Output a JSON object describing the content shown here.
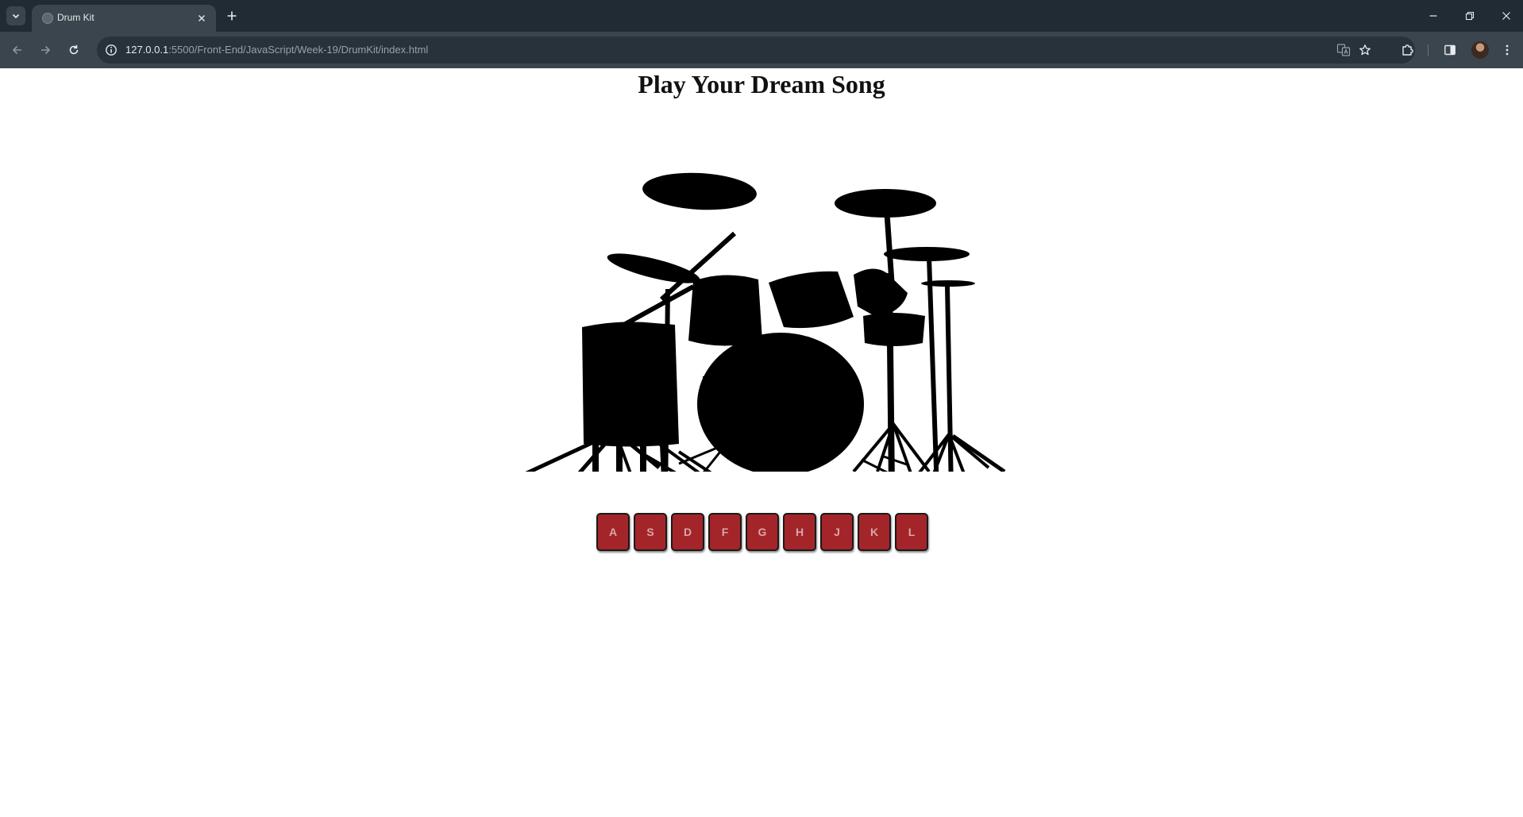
{
  "browser": {
    "tab_title": "Drum Kit",
    "url_host": "127.0.0.1",
    "url_rest": ":5500/Front-End/JavaScript/Week-19/DrumKit/index.html"
  },
  "page": {
    "title": "Play Your Dream Song",
    "keys": [
      "A",
      "S",
      "D",
      "F",
      "G",
      "H",
      "J",
      "K",
      "L"
    ]
  },
  "colors": {
    "key_background": "#a3252a",
    "key_text": "#d9a6a8",
    "tabbar": "#202b33",
    "toolbar": "#3a454d"
  },
  "icons": {
    "tab_search": "chevron-down-icon",
    "new_tab": "plus-icon",
    "back": "arrow-left-icon",
    "forward": "arrow-right-icon",
    "reload": "reload-icon",
    "site_info": "info-icon",
    "translate": "translate-icon",
    "bookmark": "star-icon",
    "extensions": "puzzle-icon",
    "side_panel": "side-panel-icon",
    "menu": "kebab-menu-icon"
  }
}
